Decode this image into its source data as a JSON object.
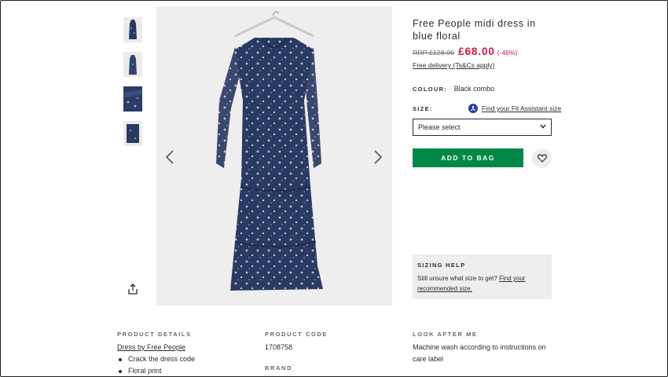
{
  "product": {
    "title": "Free People midi dress in blue floral",
    "rrp": "RRP £128.00",
    "price": "£68.00",
    "discount": "(-46%)",
    "delivery": "Free delivery (Ts&Cs apply)",
    "colour_label": "COLOUR:",
    "colour_value": "Black combo",
    "size_label": "SIZE:",
    "fit_assistant": "Find your Fit Assistant size",
    "size_select_value": "Please select",
    "add_to_bag": "ADD TO BAG"
  },
  "gallery": {
    "thumb_count": 4,
    "prev_icon": "chevron-left-icon",
    "next_icon": "chevron-right-icon",
    "share_icon": "share-icon"
  },
  "sizing_help": {
    "title": "SIZING HELP",
    "text": "Still unsure what size to get?",
    "link_part1": "Find your",
    "link_part2": "recommended size."
  },
  "details": {
    "product_details_title": "PRODUCT DETAILS",
    "product_details_link": "Dress by Free People",
    "bullets": [
      "Crack the dress code",
      "Floral print"
    ],
    "product_code_title": "PRODUCT CODE",
    "product_code": "1708758",
    "brand_title": "BRAND",
    "look_after_title": "LOOK AFTER ME",
    "look_after_text_1": "Machine wash according to instructions on",
    "look_after_text_2": "care label"
  },
  "colors": {
    "price_red": "#d01345",
    "add_button_green": "#018849",
    "dress_navy": "#2a3a63"
  }
}
